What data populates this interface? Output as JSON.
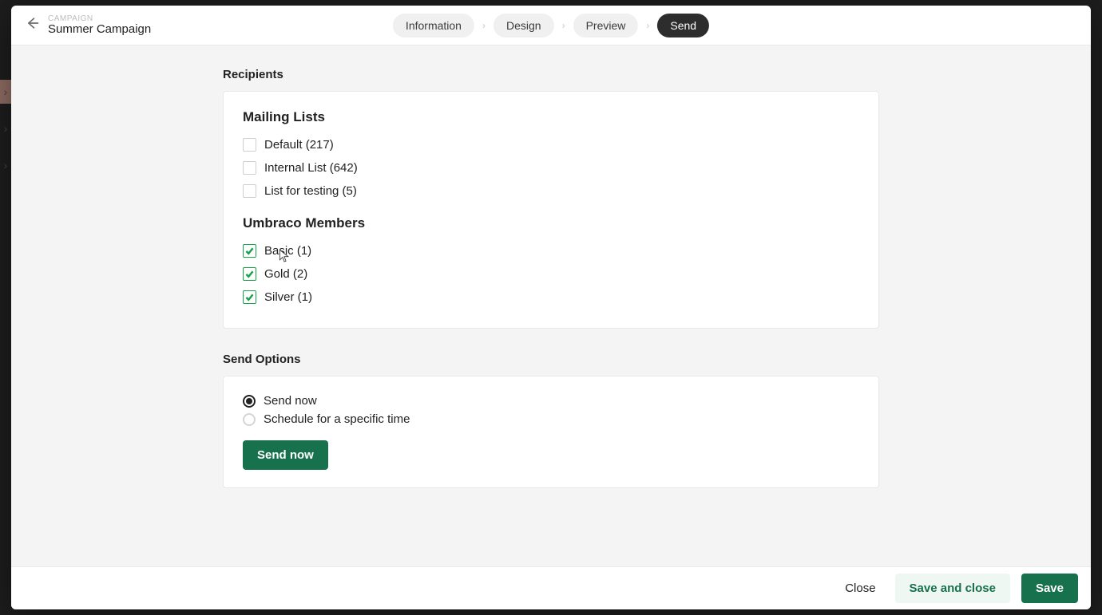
{
  "header": {
    "eyebrow": "CAMPAIGN",
    "title": "Summer Campaign",
    "steps": [
      "Information",
      "Design",
      "Preview",
      "Send"
    ],
    "active_step": "Send"
  },
  "recipients": {
    "label": "Recipients",
    "mailing_lists": {
      "heading": "Mailing Lists",
      "items": [
        {
          "label": "Default (217)",
          "checked": false
        },
        {
          "label": "Internal List (642)",
          "checked": false
        },
        {
          "label": "List for testing (5)",
          "checked": false
        }
      ]
    },
    "umbraco_members": {
      "heading": "Umbraco Members",
      "items": [
        {
          "label": "Basic (1)",
          "checked": true
        },
        {
          "label": "Gold (2)",
          "checked": true
        },
        {
          "label": "Silver (1)",
          "checked": true
        }
      ]
    }
  },
  "send_options": {
    "label": "Send Options",
    "radios": [
      {
        "label": "Send now",
        "selected": true
      },
      {
        "label": "Schedule for a specific time",
        "selected": false
      }
    ],
    "action_label": "Send now"
  },
  "footer": {
    "close": "Close",
    "save_close": "Save and close",
    "save": "Save"
  }
}
